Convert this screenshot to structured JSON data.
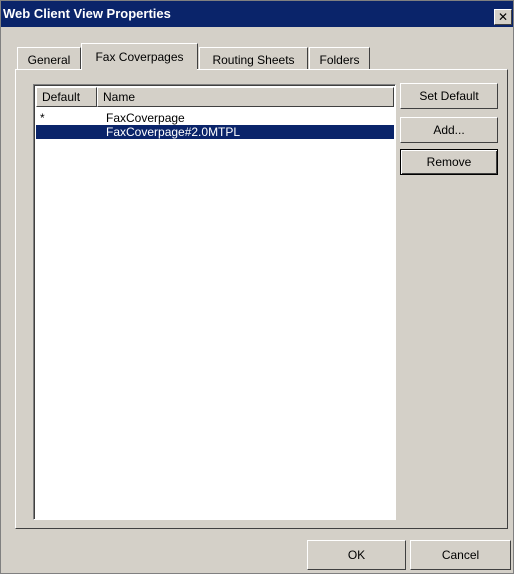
{
  "window": {
    "title": "Web Client View Properties",
    "close_glyph": "✕"
  },
  "tabs": [
    {
      "label": "General",
      "active": false
    },
    {
      "label": "Fax Coverpages",
      "active": true
    },
    {
      "label": "Routing Sheets",
      "active": false
    },
    {
      "label": "Folders",
      "active": false
    }
  ],
  "list": {
    "columns": [
      "Default",
      "Name"
    ],
    "rows": [
      {
        "default": "*",
        "name": "FaxCoverpage",
        "selected": false
      },
      {
        "default": "",
        "name": "FaxCoverpage#2.0MTPL",
        "selected": true
      }
    ]
  },
  "side_buttons": {
    "set_default": "Set Default",
    "add": "Add...",
    "remove": "Remove"
  },
  "footer": {
    "ok": "OK",
    "cancel": "Cancel"
  },
  "colors": {
    "titlebar": "#0a246a",
    "selection": "#0a246a",
    "face": "#d4d0c8"
  }
}
